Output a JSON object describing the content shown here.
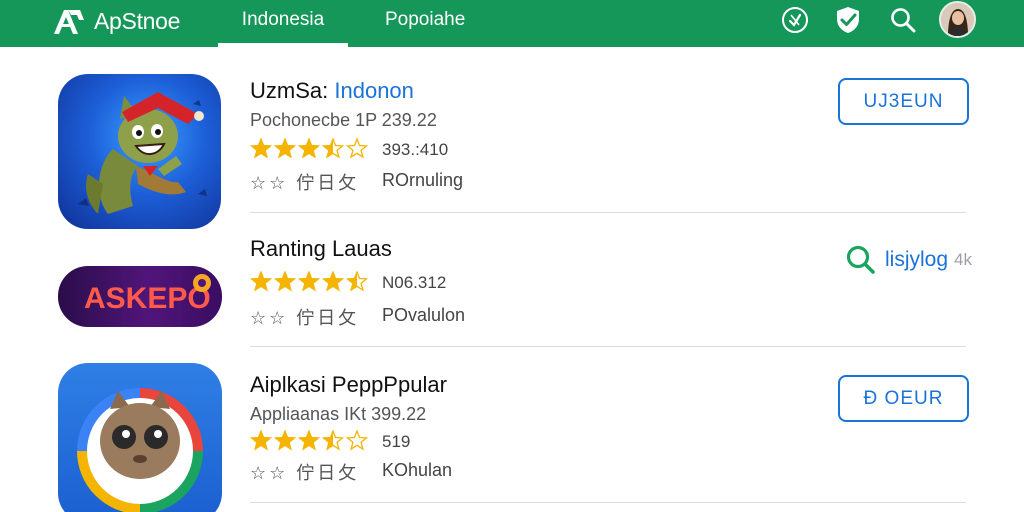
{
  "header": {
    "brand": "ApStnoe",
    "tabs": [
      {
        "label": "Indonesia",
        "active": true
      },
      {
        "label": "Popoiahe",
        "active": false
      }
    ],
    "icons": [
      "tag-icon",
      "shield-check-icon",
      "search-icon",
      "user-avatar"
    ]
  },
  "colors": {
    "header_bg": "#15975a",
    "accent_blue": "#1a73d9",
    "star_gold": "#f4b400",
    "search_green": "#1aa45f"
  },
  "apps": [
    {
      "title": "UzmSa:",
      "title_accent": "Indonon",
      "subtitle": "Pochonecbe 1P 239.22",
      "rating_stars": 3.5,
      "rating_count": "393.:410",
      "meta_glyphs": "☆☆ 佇日攵",
      "meta_text": "ROrnuling",
      "action": "UJ3EUN",
      "icon": "cat-jester-game-icon"
    },
    {
      "title": "Ranting Lauas",
      "title_accent": "",
      "subtitle": "",
      "rating_stars": 4.5,
      "rating_count": "N06.312",
      "meta_glyphs": "☆☆ 佇日攵",
      "meta_text": "POvalulon",
      "action": "lisjylog",
      "action_suffix": "4k",
      "icon": "askepo-logo-icon"
    },
    {
      "title": "Aiplkasi PeppPpular",
      "title_accent": "",
      "subtitle": "Appliaanas IKt 399.22",
      "rating_stars": 3.5,
      "rating_count": "519",
      "meta_glyphs": "☆☆ 佇日攵",
      "meta_text": "KOhulan",
      "action": "Đ OEUR",
      "icon": "owl-mascot-icon"
    }
  ],
  "banner_text": "ASKEPO"
}
